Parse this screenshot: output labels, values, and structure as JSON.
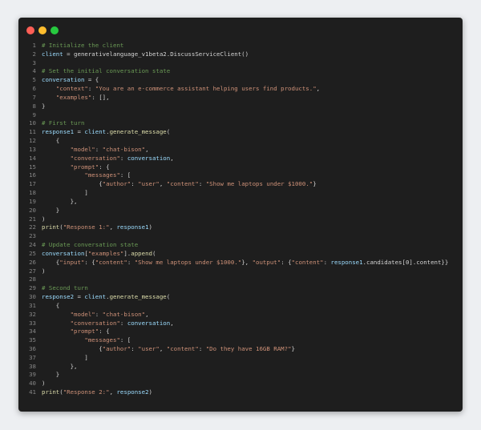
{
  "window": {
    "controls": [
      "close",
      "minimize",
      "maximize"
    ]
  },
  "colors": {
    "background": "#1e1e1e",
    "comment": "#6a9955",
    "string": "#ce9178",
    "variable": "#9cdcfe",
    "function": "#dcdcaa",
    "line_number": "#858585",
    "close": "#ff5f56",
    "minimize": "#ffbd2e",
    "maximize": "#27c93f"
  },
  "code": {
    "lines": [
      [
        [
          "c",
          "# Initialize the client"
        ]
      ],
      [
        [
          "v",
          "client"
        ],
        [
          "p",
          " = generativelanguage_v1beta2.DiscussServiceClient()"
        ]
      ],
      [
        [
          "p",
          ""
        ]
      ],
      [
        [
          "c",
          "# Set the initial conversation state"
        ]
      ],
      [
        [
          "v",
          "conversation"
        ],
        [
          "p",
          " = {"
        ]
      ],
      [
        [
          "p",
          "    "
        ],
        [
          "s",
          "\"context\""
        ],
        [
          "p",
          ": "
        ],
        [
          "s",
          "\"You are an e-commerce assistant helping users find products.\""
        ],
        [
          "p",
          ","
        ]
      ],
      [
        [
          "p",
          "    "
        ],
        [
          "s",
          "\"examples\""
        ],
        [
          "p",
          ": [],"
        ]
      ],
      [
        [
          "p",
          "}"
        ]
      ],
      [
        [
          "p",
          ""
        ]
      ],
      [
        [
          "c",
          "# First turn"
        ]
      ],
      [
        [
          "v",
          "response1"
        ],
        [
          "p",
          " = "
        ],
        [
          "v",
          "client"
        ],
        [
          "p",
          "."
        ],
        [
          "f",
          "generate_message"
        ],
        [
          "p",
          "("
        ]
      ],
      [
        [
          "p",
          "    {"
        ]
      ],
      [
        [
          "p",
          "        "
        ],
        [
          "s",
          "\"model\""
        ],
        [
          "p",
          ": "
        ],
        [
          "s",
          "\"chat-bison\""
        ],
        [
          "p",
          ","
        ]
      ],
      [
        [
          "p",
          "        "
        ],
        [
          "s",
          "\"conversation\""
        ],
        [
          "p",
          ": "
        ],
        [
          "v",
          "conversation"
        ],
        [
          "p",
          ","
        ]
      ],
      [
        [
          "p",
          "        "
        ],
        [
          "s",
          "\"prompt\""
        ],
        [
          "p",
          ": {"
        ]
      ],
      [
        [
          "p",
          "            "
        ],
        [
          "s",
          "\"messages\""
        ],
        [
          "p",
          ": ["
        ]
      ],
      [
        [
          "p",
          "                {"
        ],
        [
          "s",
          "\"author\""
        ],
        [
          "p",
          ": "
        ],
        [
          "s",
          "\"user\""
        ],
        [
          "p",
          ", "
        ],
        [
          "s",
          "\"content\""
        ],
        [
          "p",
          ": "
        ],
        [
          "s",
          "\"Show me laptops under $1000.\""
        ],
        [
          "p",
          "}"
        ]
      ],
      [
        [
          "p",
          "            ]"
        ]
      ],
      [
        [
          "p",
          "        },"
        ]
      ],
      [
        [
          "p",
          "    }"
        ]
      ],
      [
        [
          "p",
          ")"
        ]
      ],
      [
        [
          "f",
          "print"
        ],
        [
          "p",
          "("
        ],
        [
          "s",
          "\"Response 1:\""
        ],
        [
          "p",
          ", "
        ],
        [
          "v",
          "response1"
        ],
        [
          "p",
          ")"
        ]
      ],
      [
        [
          "p",
          ""
        ]
      ],
      [
        [
          "c",
          "# Update conversation state"
        ]
      ],
      [
        [
          "v",
          "conversation"
        ],
        [
          "p",
          "["
        ],
        [
          "s",
          "\"examples\""
        ],
        [
          "p",
          "]."
        ],
        [
          "f",
          "append"
        ],
        [
          "p",
          "("
        ]
      ],
      [
        [
          "p",
          "    {"
        ],
        [
          "s",
          "\"input\""
        ],
        [
          "p",
          ": {"
        ],
        [
          "s",
          "\"content\""
        ],
        [
          "p",
          ": "
        ],
        [
          "s",
          "\"Show me laptops under $1000.\""
        ],
        [
          "p",
          "}, "
        ],
        [
          "s",
          "\"output\""
        ],
        [
          "p",
          ": {"
        ],
        [
          "s",
          "\"content\""
        ],
        [
          "p",
          ": "
        ],
        [
          "v",
          "response1"
        ],
        [
          "p",
          ".candidates[0].content}}"
        ]
      ],
      [
        [
          "p",
          ")"
        ]
      ],
      [
        [
          "p",
          ""
        ]
      ],
      [
        [
          "c",
          "# Second turn"
        ]
      ],
      [
        [
          "v",
          "response2"
        ],
        [
          "p",
          " = "
        ],
        [
          "v",
          "client"
        ],
        [
          "p",
          "."
        ],
        [
          "f",
          "generate_message"
        ],
        [
          "p",
          "("
        ]
      ],
      [
        [
          "p",
          "    {"
        ]
      ],
      [
        [
          "p",
          "        "
        ],
        [
          "s",
          "\"model\""
        ],
        [
          "p",
          ": "
        ],
        [
          "s",
          "\"chat-bison\""
        ],
        [
          "p",
          ","
        ]
      ],
      [
        [
          "p",
          "        "
        ],
        [
          "s",
          "\"conversation\""
        ],
        [
          "p",
          ": "
        ],
        [
          "v",
          "conversation"
        ],
        [
          "p",
          ","
        ]
      ],
      [
        [
          "p",
          "        "
        ],
        [
          "s",
          "\"prompt\""
        ],
        [
          "p",
          ": {"
        ]
      ],
      [
        [
          "p",
          "            "
        ],
        [
          "s",
          "\"messages\""
        ],
        [
          "p",
          ": ["
        ]
      ],
      [
        [
          "p",
          "                {"
        ],
        [
          "s",
          "\"author\""
        ],
        [
          "p",
          ": "
        ],
        [
          "s",
          "\"user\""
        ],
        [
          "p",
          ", "
        ],
        [
          "s",
          "\"content\""
        ],
        [
          "p",
          ": "
        ],
        [
          "s",
          "\"Do they have 16GB RAM?\""
        ],
        [
          "p",
          "}"
        ]
      ],
      [
        [
          "p",
          "            ]"
        ]
      ],
      [
        [
          "p",
          "        },"
        ]
      ],
      [
        [
          "p",
          "    }"
        ]
      ],
      [
        [
          "p",
          ")"
        ]
      ],
      [
        [
          "f",
          "print"
        ],
        [
          "p",
          "("
        ],
        [
          "s",
          "\"Response 2:\""
        ],
        [
          "p",
          ", "
        ],
        [
          "v",
          "response2"
        ],
        [
          "p",
          ")"
        ]
      ]
    ]
  }
}
